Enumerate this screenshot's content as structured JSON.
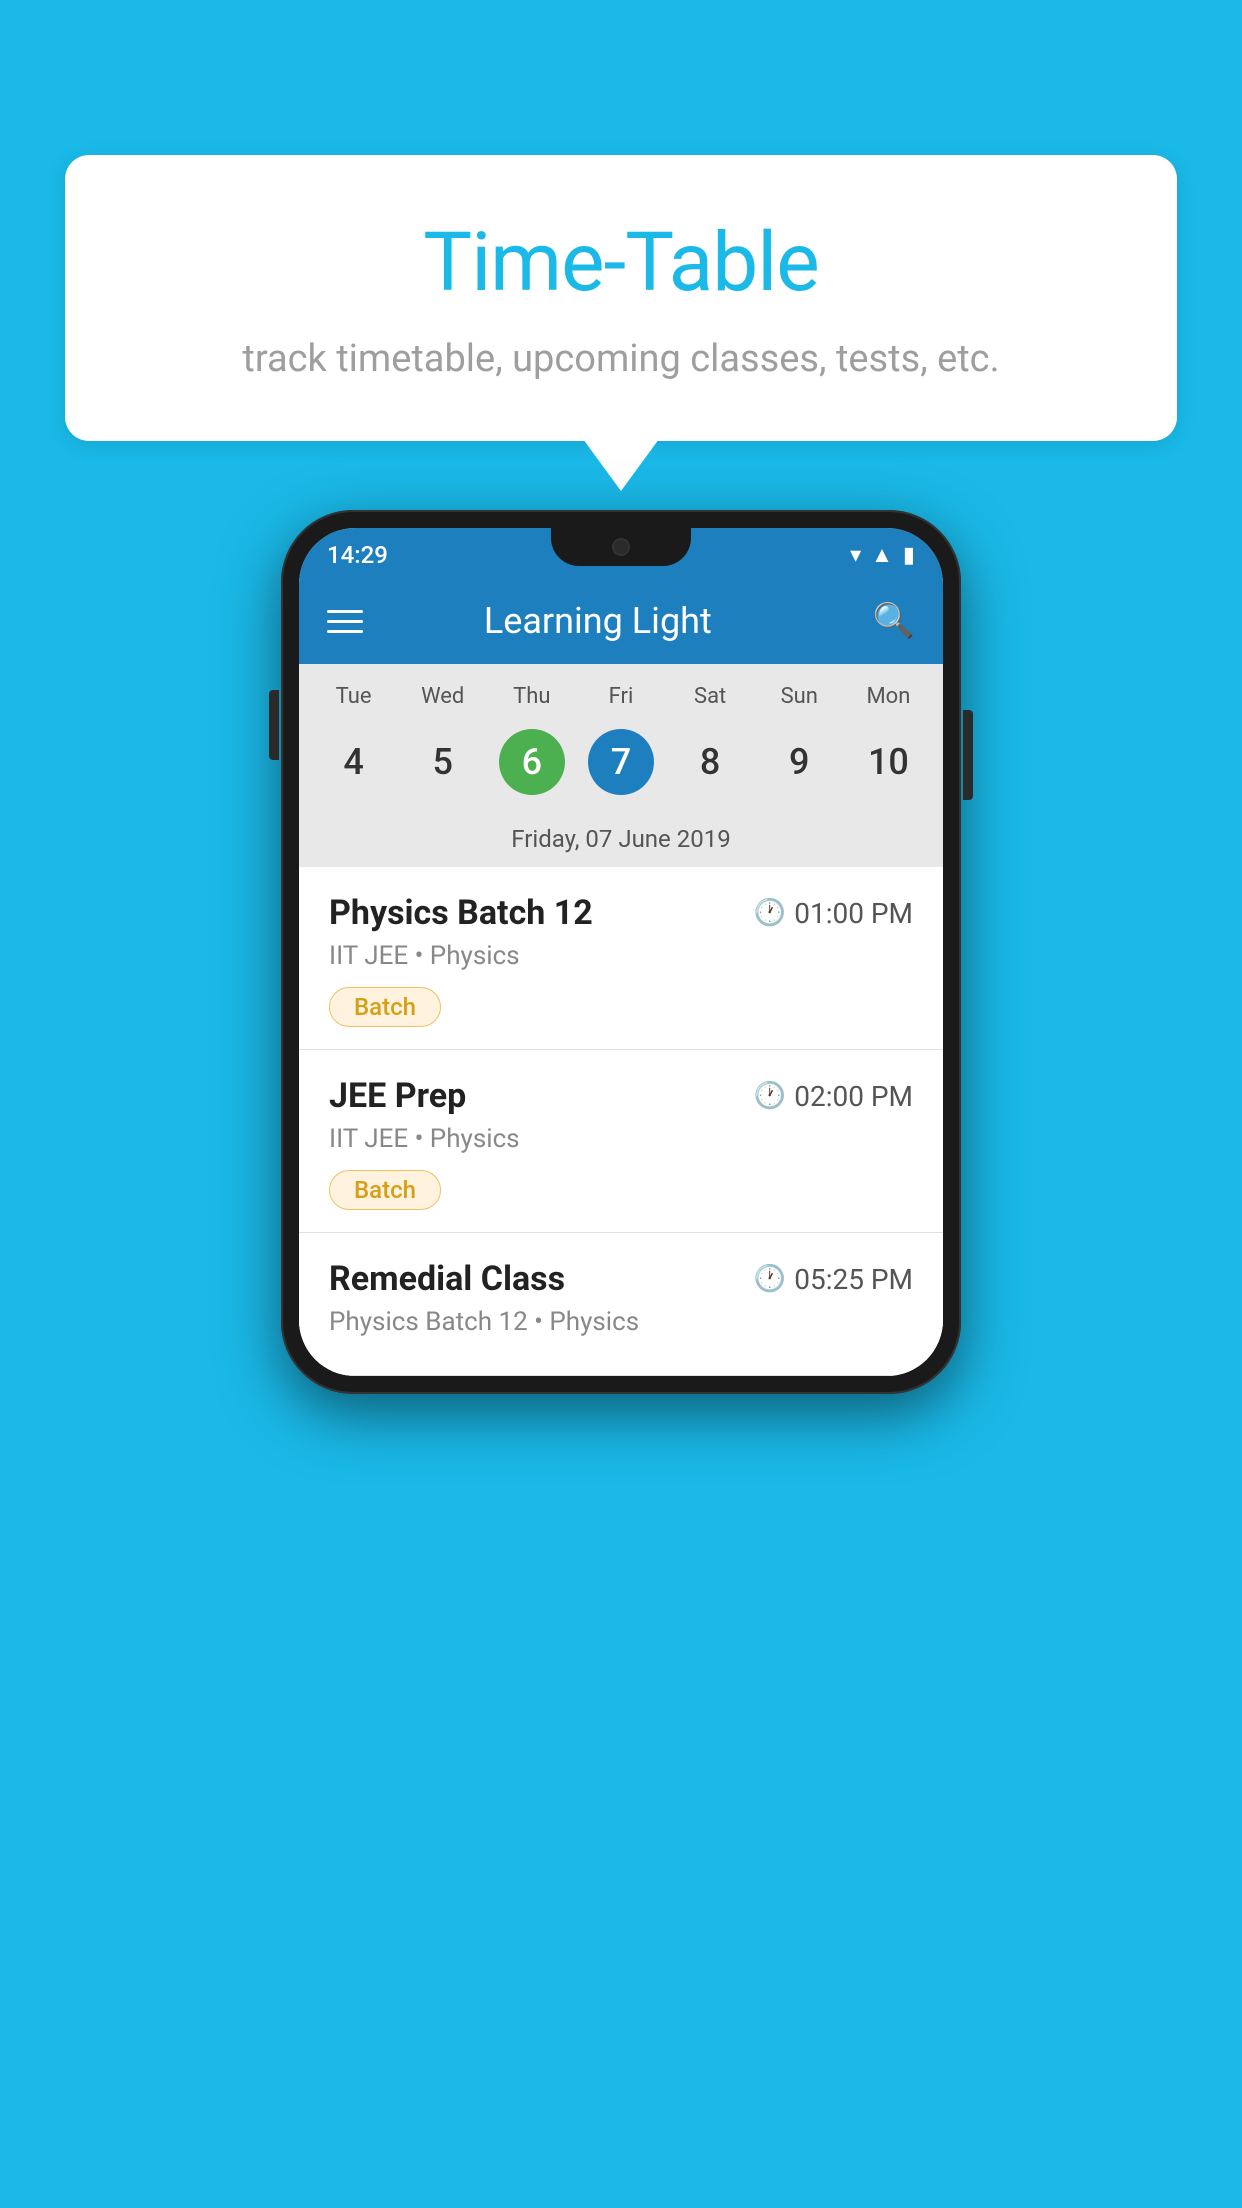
{
  "background_color": "#1ab9e8",
  "bubble": {
    "title": "Time-Table",
    "subtitle": "track timetable, upcoming classes, tests, etc."
  },
  "phone": {
    "status_bar": {
      "time": "14:29"
    },
    "app_bar": {
      "title": "Learning Light"
    },
    "calendar": {
      "days": [
        "Tue",
        "Wed",
        "Thu",
        "Fri",
        "Sat",
        "Sun",
        "Mon"
      ],
      "dates": [
        "4",
        "5",
        "6",
        "7",
        "8",
        "9",
        "10"
      ],
      "today_index": 2,
      "selected_index": 3,
      "date_label": "Friday, 07 June 2019"
    },
    "classes": [
      {
        "name": "Physics Batch 12",
        "time": "01:00 PM",
        "subtitle": "IIT JEE • Physics",
        "badge": "Batch"
      },
      {
        "name": "JEE Prep",
        "time": "02:00 PM",
        "subtitle": "IIT JEE • Physics",
        "badge": "Batch"
      },
      {
        "name": "Remedial Class",
        "time": "05:25 PM",
        "subtitle": "Physics Batch 12 • Physics",
        "badge": ""
      }
    ]
  }
}
